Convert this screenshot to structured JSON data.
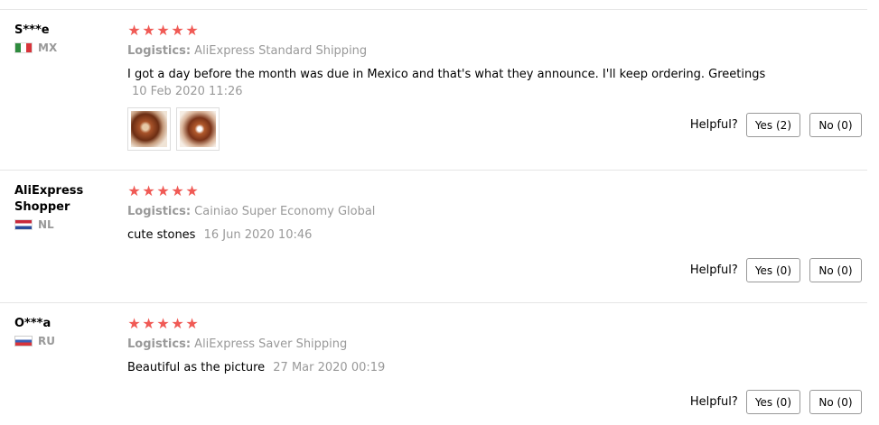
{
  "reviews": [
    {
      "reviewer": "S***e",
      "country_code": "MX",
      "rating": 5,
      "logistics_label": "Logistics:",
      "logistics": "AliExpress Standard Shipping",
      "text": "I got a day before the month was due in Mexico and that's what they announce. I'll keep ordering. Greetings",
      "date": "10 Feb 2020 11:26",
      "photos": [
        "review-photo-1",
        "review-photo-2"
      ],
      "helpful_label": "Helpful?",
      "yes_label": "Yes (2)",
      "no_label": "No (0)"
    },
    {
      "reviewer": "AliExpress Shopper",
      "country_code": "NL",
      "rating": 5,
      "logistics_label": "Logistics:",
      "logistics": "Cainiao Super Economy Global",
      "text": "cute stones",
      "date": "16 Jun 2020 10:46",
      "helpful_label": "Helpful?",
      "yes_label": "Yes (0)",
      "no_label": "No (0)"
    },
    {
      "reviewer": "O***a",
      "country_code": "RU",
      "rating": 5,
      "logistics_label": "Logistics:",
      "logistics": "AliExpress Saver Shipping",
      "text": "Beautiful as the picture",
      "date": "27 Mar 2020 00:19",
      "helpful_label": "Helpful?",
      "yes_label": "Yes (0)",
      "no_label": "No (0)"
    }
  ],
  "colors": {
    "star": "#f05a55",
    "muted_text": "#999999",
    "divider": "#e6e6e6",
    "button_border": "#999999"
  },
  "icons": {
    "star": "star-icon",
    "flag_mx": "mexico-flag-icon",
    "flag_nl": "netherlands-flag-icon",
    "flag_ru": "russia-flag-icon"
  }
}
